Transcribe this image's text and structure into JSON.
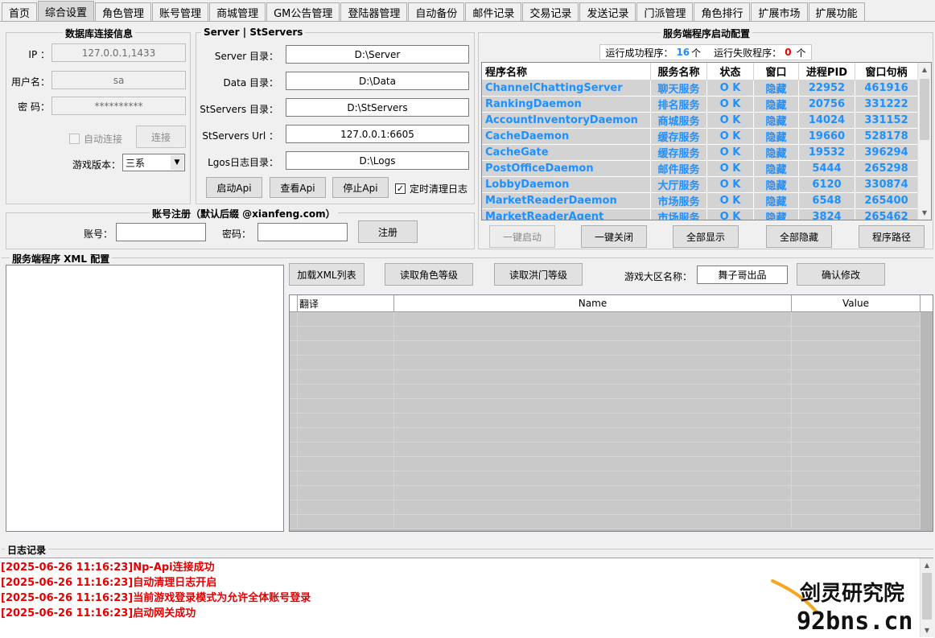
{
  "tabs": [
    "首页",
    "综合设置",
    "角色管理",
    "账号管理",
    "商城管理",
    "GM公告管理",
    "登陆器管理",
    "自动备份",
    "邮件记录",
    "交易记录",
    "发送记录",
    "门派管理",
    "角色排行",
    "扩展市场",
    "扩展功能"
  ],
  "db": {
    "title": "数据库连接信息",
    "ip_label": "IP ：",
    "ip_value": "127.0.0.1,1433",
    "user_label": "用户名：",
    "user_value": "sa",
    "pwd_label": "密   码：",
    "pwd_value": "**********",
    "auto_connect": "自动连接",
    "connect_button": "连接",
    "version_label": "游戏版本：",
    "version_value": "三系"
  },
  "server": {
    "title": "Server | StServers",
    "server_dir_label": "Server 目录：",
    "server_dir": "D:\\Server",
    "data_dir_label": "Data 目录：",
    "data_dir": "D:\\Data",
    "st_dir_label": "StServers 目录：",
    "st_dir": "D:\\StServers",
    "st_url_label": "StServers Url ：",
    "st_url": "127.0.0.1:6605",
    "log_dir_label": "Lgos日志目录：",
    "log_dir": "D:\\Logs",
    "start_api": "启动Api",
    "view_api": "查看Api",
    "stop_api": "停止Api",
    "clear_log": "定时清理日志"
  },
  "register": {
    "title": "账号注册（默认后缀 @xianfeng.com）",
    "account_label": "账号：",
    "password_label": "密码：",
    "register_button": "注册"
  },
  "process": {
    "title": "服务端程序启动配置",
    "success_label": "运行成功程序：",
    "success_count": "16",
    "success_unit": "个",
    "fail_label": "运行失败程序：",
    "fail_count": "0",
    "fail_unit": "个",
    "headers": [
      "程序名称",
      "服务名称",
      "状态",
      "窗口",
      "进程PID",
      "窗口句柄"
    ],
    "rows": [
      [
        "ChannelChattingServer",
        "聊天服务",
        "O K",
        "隐藏",
        "22952",
        "461916"
      ],
      [
        "RankingDaemon",
        "排名服务",
        "O K",
        "隐藏",
        "20756",
        "331222"
      ],
      [
        "AccountInventoryDaemon",
        "商城服务",
        "O K",
        "隐藏",
        "14024",
        "331152"
      ],
      [
        "CacheDaemon",
        "缓存服务",
        "O K",
        "隐藏",
        "19660",
        "528178"
      ],
      [
        "CacheGate",
        "缓存服务",
        "O K",
        "隐藏",
        "19532",
        "396294"
      ],
      [
        "PostOfficeDaemon",
        "邮件服务",
        "O K",
        "隐藏",
        "5444",
        "265298"
      ],
      [
        "LobbyDaemon",
        "大厅服务",
        "O K",
        "隐藏",
        "6120",
        "330874"
      ],
      [
        "MarketReaderDaemon",
        "市场服务",
        "O K",
        "隐藏",
        "6548",
        "265400"
      ],
      [
        "MarketReaderAgent",
        "市场服务",
        "O K",
        "隐藏",
        "3824",
        "265462"
      ]
    ],
    "start_all": "一键启动",
    "close_all": "一键关闭",
    "show_all": "全部显示",
    "hide_all": "全部隐藏",
    "program_path": "程序路径"
  },
  "xml": {
    "title": "服务端程序 XML 配置",
    "load_xml": "加载XML列表",
    "read_role_level": "读取角色等级",
    "read_hongmen_level": "读取洪门等级",
    "zone_label": "游戏大区名称：",
    "zone_value": "舞子哥出品",
    "confirm": "确认修改",
    "headers": [
      "翻译",
      "Name",
      "Value"
    ]
  },
  "log": {
    "title": "日志记录",
    "lines": [
      "[2025-06-26 11:16:23]Np-Api连接成功",
      "[2025-06-26 11:16:23]自动清理日志开启",
      "[2025-06-26 11:16:23]当前游戏登录模式为允许全体账号登录",
      "[2025-06-26 11:16:23]启动网关成功"
    ]
  },
  "watermark": {
    "line1": "剑灵研究院",
    "line2": "92bns.cn",
    "accent": "#f5a623"
  }
}
